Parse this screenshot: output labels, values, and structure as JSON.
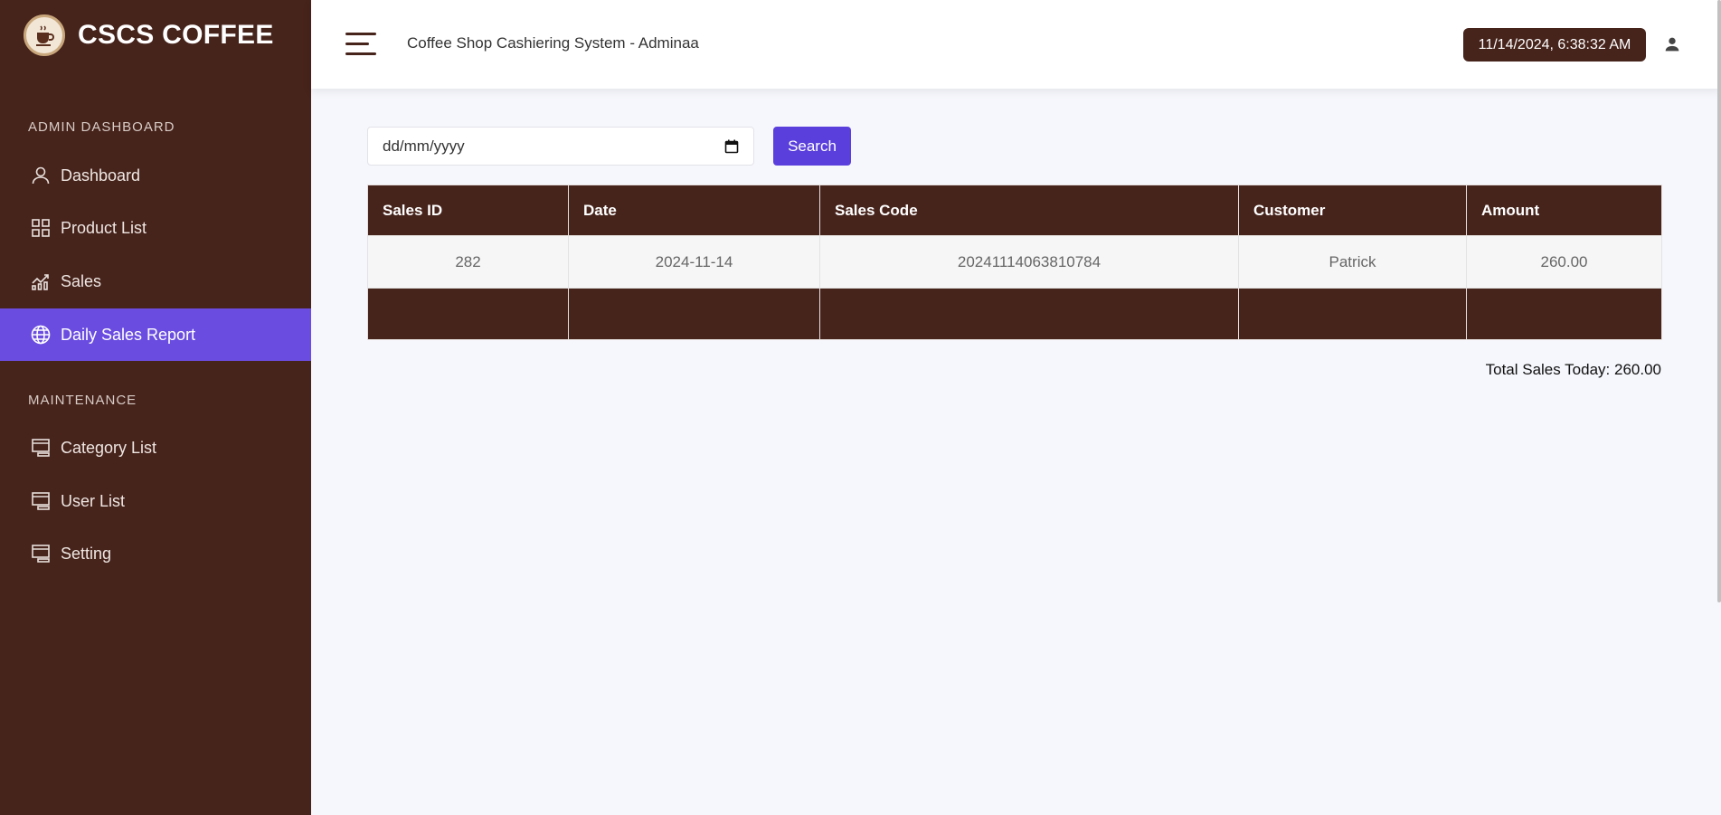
{
  "sidebar": {
    "brand": "CSCS COFFEE",
    "sections": [
      {
        "heading": "ADMIN DASHBOARD",
        "items": [
          {
            "label": "Dashboard",
            "icon": "user-icon"
          },
          {
            "label": "Product List",
            "icon": "grid-icon"
          },
          {
            "label": "Sales",
            "icon": "chart-icon"
          },
          {
            "label": "Daily Sales Report",
            "icon": "globe-icon",
            "active": true
          }
        ]
      },
      {
        "heading": "MAINTENANCE",
        "items": [
          {
            "label": "Category List",
            "icon": "monitor-icon"
          },
          {
            "label": "User List",
            "icon": "monitor-icon"
          },
          {
            "label": "Setting",
            "icon": "monitor-icon"
          }
        ]
      }
    ]
  },
  "header": {
    "title": "Coffee Shop Cashiering System - Adminaa",
    "datetime": "11/14/2024, 6:38:32 AM"
  },
  "filter": {
    "date_placeholder": "dd/mm/yyyy",
    "search_label": "Search"
  },
  "table": {
    "columns": [
      "Sales ID",
      "Date",
      "Sales Code",
      "Customer",
      "Amount"
    ],
    "rows": [
      [
        "282",
        "2024-11-14",
        "20241114063810784",
        "Patrick",
        "260.00"
      ]
    ]
  },
  "total": {
    "text": "Total Sales Today: 260.00"
  },
  "colors": {
    "sidebar_bg": "#46231b",
    "active_item": "#6a4de0",
    "accent_button": "#5a3fdc",
    "page_bg": "#f6f7fc"
  }
}
